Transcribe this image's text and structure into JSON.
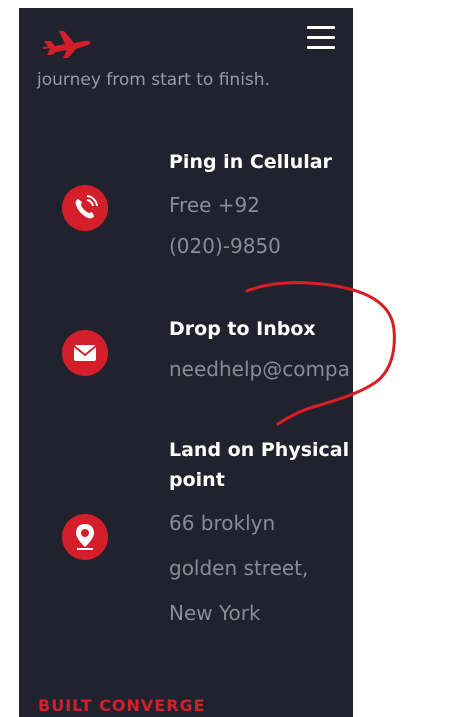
{
  "header": {
    "logo_icon": "airplane-icon",
    "menu_icon": "hamburger-menu-icon"
  },
  "intro": {
    "tagline": "journey from start to finish."
  },
  "contacts": [
    {
      "icon": "phone-icon",
      "title": "Ping in Cellular",
      "lines": [
        "Free +92",
        "(020)-9850"
      ]
    },
    {
      "icon": "envelope-icon",
      "title": "Drop to Inbox",
      "lines": [
        "needhelp@compa"
      ]
    },
    {
      "icon": "location-pin-icon",
      "title_lines": [
        "Land on Physical",
        "point"
      ],
      "lines": [
        "66 broklyn",
        "golden street,",
        "New York"
      ]
    }
  ],
  "footer": {
    "label": "BUILT CONVERGE"
  },
  "colors": {
    "panel_bg": "#22222f",
    "accent": "#d41f2a",
    "title_text": "#ffffff",
    "muted_text": "#8b8b96"
  }
}
